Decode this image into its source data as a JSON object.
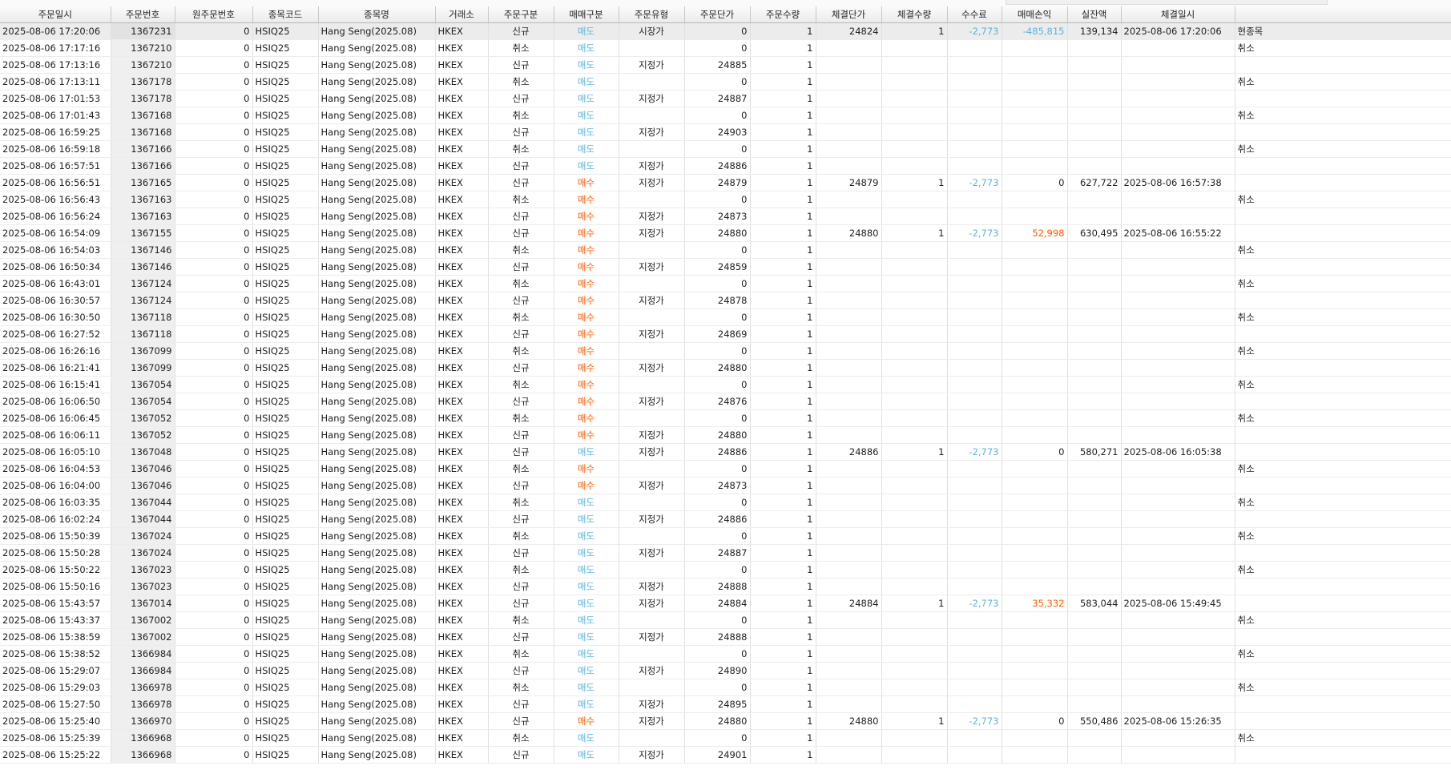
{
  "columns": [
    "주문일시",
    "주문번호",
    "원주문번호",
    "종목코드",
    "종목명",
    "거래소",
    "주문구분",
    "매매구분",
    "주문유형",
    "주문단가",
    "주문수량",
    "체결단가",
    "체결수량",
    "수수료",
    "매매손익",
    "실잔액",
    "체결일시",
    ""
  ],
  "rows": [
    [
      "2025-08-06 17:20:06",
      "1367231",
      "0",
      "HSIQ25",
      "Hang Seng(2025.08)",
      "HKEX",
      "신규",
      "매도",
      "시장가",
      "0",
      "1",
      "24824",
      "1",
      "-2,773",
      "-485,815",
      "139,134",
      "2025-08-06 17:20:06",
      "현종목"
    ],
    [
      "2025-08-06 17:17:16",
      "1367210",
      "0",
      "HSIQ25",
      "Hang Seng(2025.08)",
      "HKEX",
      "취소",
      "매도",
      "",
      "0",
      "1",
      "",
      "",
      "",
      "",
      "",
      "",
      "취소"
    ],
    [
      "2025-08-06 17:13:16",
      "1367210",
      "0",
      "HSIQ25",
      "Hang Seng(2025.08)",
      "HKEX",
      "신규",
      "매도",
      "지정가",
      "24885",
      "1",
      "",
      "",
      "",
      "",
      "",
      "",
      ""
    ],
    [
      "2025-08-06 17:13:11",
      "1367178",
      "0",
      "HSIQ25",
      "Hang Seng(2025.08)",
      "HKEX",
      "취소",
      "매도",
      "",
      "0",
      "1",
      "",
      "",
      "",
      "",
      "",
      "",
      "취소"
    ],
    [
      "2025-08-06 17:01:53",
      "1367178",
      "0",
      "HSIQ25",
      "Hang Seng(2025.08)",
      "HKEX",
      "신규",
      "매도",
      "지정가",
      "24887",
      "1",
      "",
      "",
      "",
      "",
      "",
      "",
      ""
    ],
    [
      "2025-08-06 17:01:43",
      "1367168",
      "0",
      "HSIQ25",
      "Hang Seng(2025.08)",
      "HKEX",
      "취소",
      "매도",
      "",
      "0",
      "1",
      "",
      "",
      "",
      "",
      "",
      "",
      "취소"
    ],
    [
      "2025-08-06 16:59:25",
      "1367168",
      "0",
      "HSIQ25",
      "Hang Seng(2025.08)",
      "HKEX",
      "신규",
      "매도",
      "지정가",
      "24903",
      "1",
      "",
      "",
      "",
      "",
      "",
      "",
      ""
    ],
    [
      "2025-08-06 16:59:18",
      "1367166",
      "0",
      "HSIQ25",
      "Hang Seng(2025.08)",
      "HKEX",
      "취소",
      "매도",
      "",
      "0",
      "1",
      "",
      "",
      "",
      "",
      "",
      "",
      "취소"
    ],
    [
      "2025-08-06 16:57:51",
      "1367166",
      "0",
      "HSIQ25",
      "Hang Seng(2025.08)",
      "HKEX",
      "신규",
      "매도",
      "지정가",
      "24886",
      "1",
      "",
      "",
      "",
      "",
      "",
      "",
      ""
    ],
    [
      "2025-08-06 16:56:51",
      "1367165",
      "0",
      "HSIQ25",
      "Hang Seng(2025.08)",
      "HKEX",
      "신규",
      "매수",
      "지정가",
      "24879",
      "1",
      "24879",
      "1",
      "-2,773",
      "0",
      "627,722",
      "2025-08-06 16:57:38",
      ""
    ],
    [
      "2025-08-06 16:56:43",
      "1367163",
      "0",
      "HSIQ25",
      "Hang Seng(2025.08)",
      "HKEX",
      "취소",
      "매수",
      "",
      "0",
      "1",
      "",
      "",
      "",
      "",
      "",
      "",
      "취소"
    ],
    [
      "2025-08-06 16:56:24",
      "1367163",
      "0",
      "HSIQ25",
      "Hang Seng(2025.08)",
      "HKEX",
      "신규",
      "매수",
      "지정가",
      "24873",
      "1",
      "",
      "",
      "",
      "",
      "",
      "",
      ""
    ],
    [
      "2025-08-06 16:54:09",
      "1367155",
      "0",
      "HSIQ25",
      "Hang Seng(2025.08)",
      "HKEX",
      "신규",
      "매수",
      "지정가",
      "24880",
      "1",
      "24880",
      "1",
      "-2,773",
      "52,998",
      "630,495",
      "2025-08-06 16:55:22",
      ""
    ],
    [
      "2025-08-06 16:54:03",
      "1367146",
      "0",
      "HSIQ25",
      "Hang Seng(2025.08)",
      "HKEX",
      "취소",
      "매수",
      "",
      "0",
      "1",
      "",
      "",
      "",
      "",
      "",
      "",
      "취소"
    ],
    [
      "2025-08-06 16:50:34",
      "1367146",
      "0",
      "HSIQ25",
      "Hang Seng(2025.08)",
      "HKEX",
      "신규",
      "매수",
      "지정가",
      "24859",
      "1",
      "",
      "",
      "",
      "",
      "",
      "",
      ""
    ],
    [
      "2025-08-06 16:43:01",
      "1367124",
      "0",
      "HSIQ25",
      "Hang Seng(2025.08)",
      "HKEX",
      "취소",
      "매수",
      "",
      "0",
      "1",
      "",
      "",
      "",
      "",
      "",
      "",
      "취소"
    ],
    [
      "2025-08-06 16:30:57",
      "1367124",
      "0",
      "HSIQ25",
      "Hang Seng(2025.08)",
      "HKEX",
      "신규",
      "매수",
      "지정가",
      "24878",
      "1",
      "",
      "",
      "",
      "",
      "",
      "",
      ""
    ],
    [
      "2025-08-06 16:30:50",
      "1367118",
      "0",
      "HSIQ25",
      "Hang Seng(2025.08)",
      "HKEX",
      "취소",
      "매수",
      "",
      "0",
      "1",
      "",
      "",
      "",
      "",
      "",
      "",
      "취소"
    ],
    [
      "2025-08-06 16:27:52",
      "1367118",
      "0",
      "HSIQ25",
      "Hang Seng(2025.08)",
      "HKEX",
      "신규",
      "매수",
      "지정가",
      "24869",
      "1",
      "",
      "",
      "",
      "",
      "",
      "",
      ""
    ],
    [
      "2025-08-06 16:26:16",
      "1367099",
      "0",
      "HSIQ25",
      "Hang Seng(2025.08)",
      "HKEX",
      "취소",
      "매수",
      "",
      "0",
      "1",
      "",
      "",
      "",
      "",
      "",
      "",
      "취소"
    ],
    [
      "2025-08-06 16:21:41",
      "1367099",
      "0",
      "HSIQ25",
      "Hang Seng(2025.08)",
      "HKEX",
      "신규",
      "매수",
      "지정가",
      "24880",
      "1",
      "",
      "",
      "",
      "",
      "",
      "",
      ""
    ],
    [
      "2025-08-06 16:15:41",
      "1367054",
      "0",
      "HSIQ25",
      "Hang Seng(2025.08)",
      "HKEX",
      "취소",
      "매수",
      "",
      "0",
      "1",
      "",
      "",
      "",
      "",
      "",
      "",
      "취소"
    ],
    [
      "2025-08-06 16:06:50",
      "1367054",
      "0",
      "HSIQ25",
      "Hang Seng(2025.08)",
      "HKEX",
      "신규",
      "매수",
      "지정가",
      "24876",
      "1",
      "",
      "",
      "",
      "",
      "",
      "",
      ""
    ],
    [
      "2025-08-06 16:06:45",
      "1367052",
      "0",
      "HSIQ25",
      "Hang Seng(2025.08)",
      "HKEX",
      "취소",
      "매수",
      "",
      "0",
      "1",
      "",
      "",
      "",
      "",
      "",
      "",
      "취소"
    ],
    [
      "2025-08-06 16:06:11",
      "1367052",
      "0",
      "HSIQ25",
      "Hang Seng(2025.08)",
      "HKEX",
      "신규",
      "매수",
      "지정가",
      "24880",
      "1",
      "",
      "",
      "",
      "",
      "",
      "",
      ""
    ],
    [
      "2025-08-06 16:05:10",
      "1367048",
      "0",
      "HSIQ25",
      "Hang Seng(2025.08)",
      "HKEX",
      "신규",
      "매도",
      "지정가",
      "24886",
      "1",
      "24886",
      "1",
      "-2,773",
      "0",
      "580,271",
      "2025-08-06 16:05:38",
      ""
    ],
    [
      "2025-08-06 16:04:53",
      "1367046",
      "0",
      "HSIQ25",
      "Hang Seng(2025.08)",
      "HKEX",
      "취소",
      "매수",
      "",
      "0",
      "1",
      "",
      "",
      "",
      "",
      "",
      "",
      "취소"
    ],
    [
      "2025-08-06 16:04:00",
      "1367046",
      "0",
      "HSIQ25",
      "Hang Seng(2025.08)",
      "HKEX",
      "신규",
      "매수",
      "지정가",
      "24873",
      "1",
      "",
      "",
      "",
      "",
      "",
      "",
      ""
    ],
    [
      "2025-08-06 16:03:35",
      "1367044",
      "0",
      "HSIQ25",
      "Hang Seng(2025.08)",
      "HKEX",
      "취소",
      "매도",
      "",
      "0",
      "1",
      "",
      "",
      "",
      "",
      "",
      "",
      "취소"
    ],
    [
      "2025-08-06 16:02:24",
      "1367044",
      "0",
      "HSIQ25",
      "Hang Seng(2025.08)",
      "HKEX",
      "신규",
      "매도",
      "지정가",
      "24886",
      "1",
      "",
      "",
      "",
      "",
      "",
      "",
      ""
    ],
    [
      "2025-08-06 15:50:39",
      "1367024",
      "0",
      "HSIQ25",
      "Hang Seng(2025.08)",
      "HKEX",
      "취소",
      "매도",
      "",
      "0",
      "1",
      "",
      "",
      "",
      "",
      "",
      "",
      "취소"
    ],
    [
      "2025-08-06 15:50:28",
      "1367024",
      "0",
      "HSIQ25",
      "Hang Seng(2025.08)",
      "HKEX",
      "신규",
      "매도",
      "지정가",
      "24887",
      "1",
      "",
      "",
      "",
      "",
      "",
      "",
      ""
    ],
    [
      "2025-08-06 15:50:22",
      "1367023",
      "0",
      "HSIQ25",
      "Hang Seng(2025.08)",
      "HKEX",
      "취소",
      "매도",
      "",
      "0",
      "1",
      "",
      "",
      "",
      "",
      "",
      "",
      "취소"
    ],
    [
      "2025-08-06 15:50:16",
      "1367023",
      "0",
      "HSIQ25",
      "Hang Seng(2025.08)",
      "HKEX",
      "신규",
      "매도",
      "지정가",
      "24888",
      "1",
      "",
      "",
      "",
      "",
      "",
      "",
      ""
    ],
    [
      "2025-08-06 15:43:57",
      "1367014",
      "0",
      "HSIQ25",
      "Hang Seng(2025.08)",
      "HKEX",
      "신규",
      "매도",
      "지정가",
      "24884",
      "1",
      "24884",
      "1",
      "-2,773",
      "35,332",
      "583,044",
      "2025-08-06 15:49:45",
      ""
    ],
    [
      "2025-08-06 15:43:37",
      "1367002",
      "0",
      "HSIQ25",
      "Hang Seng(2025.08)",
      "HKEX",
      "취소",
      "매도",
      "",
      "0",
      "1",
      "",
      "",
      "",
      "",
      "",
      "",
      "취소"
    ],
    [
      "2025-08-06 15:38:59",
      "1367002",
      "0",
      "HSIQ25",
      "Hang Seng(2025.08)",
      "HKEX",
      "신규",
      "매도",
      "지정가",
      "24888",
      "1",
      "",
      "",
      "",
      "",
      "",
      "",
      ""
    ],
    [
      "2025-08-06 15:38:52",
      "1366984",
      "0",
      "HSIQ25",
      "Hang Seng(2025.08)",
      "HKEX",
      "취소",
      "매도",
      "",
      "0",
      "1",
      "",
      "",
      "",
      "",
      "",
      "",
      "취소"
    ],
    [
      "2025-08-06 15:29:07",
      "1366984",
      "0",
      "HSIQ25",
      "Hang Seng(2025.08)",
      "HKEX",
      "신규",
      "매도",
      "지정가",
      "24890",
      "1",
      "",
      "",
      "",
      "",
      "",
      "",
      ""
    ],
    [
      "2025-08-06 15:29:03",
      "1366978",
      "0",
      "HSIQ25",
      "Hang Seng(2025.08)",
      "HKEX",
      "취소",
      "매도",
      "",
      "0",
      "1",
      "",
      "",
      "",
      "",
      "",
      "",
      "취소"
    ],
    [
      "2025-08-06 15:27:50",
      "1366978",
      "0",
      "HSIQ25",
      "Hang Seng(2025.08)",
      "HKEX",
      "신규",
      "매도",
      "지정가",
      "24895",
      "1",
      "",
      "",
      "",
      "",
      "",
      "",
      ""
    ],
    [
      "2025-08-06 15:25:40",
      "1366970",
      "0",
      "HSIQ25",
      "Hang Seng(2025.08)",
      "HKEX",
      "신규",
      "매수",
      "지정가",
      "24880",
      "1",
      "24880",
      "1",
      "-2,773",
      "0",
      "550,486",
      "2025-08-06 15:26:35",
      ""
    ],
    [
      "2025-08-06 15:25:39",
      "1366968",
      "0",
      "HSIQ25",
      "Hang Seng(2025.08)",
      "HKEX",
      "취소",
      "매도",
      "",
      "0",
      "1",
      "",
      "",
      "",
      "",
      "",
      "",
      "취소"
    ],
    [
      "2025-08-06 15:25:22",
      "1366968",
      "0",
      "HSIQ25",
      "Hang Seng(2025.08)",
      "HKEX",
      "신규",
      "매도",
      "지정가",
      "24901",
      "1",
      "",
      "",
      "",
      "",
      "",
      "",
      ""
    ]
  ],
  "colors": {
    "sell": "#5ab4dc",
    "buy": "#ff5a00",
    "fee": "#5ab4dc",
    "loss": "#5ab4dc",
    "profit": "#ff5a00"
  }
}
